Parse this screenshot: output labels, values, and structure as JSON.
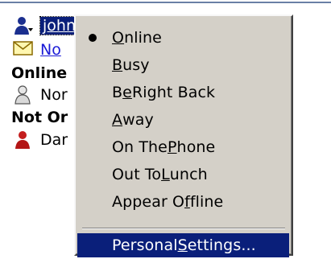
{
  "contacts": {
    "current_user": "john",
    "link_text": "No",
    "group_online": "Online",
    "contact_online": "Nor",
    "group_offline": "Not Or",
    "contact_offline": "Dar"
  },
  "menu": {
    "items": [
      {
        "pre": "",
        "acc": "O",
        "post": "nline",
        "checked": true
      },
      {
        "pre": "",
        "acc": "B",
        "post": "usy"
      },
      {
        "pre": "B",
        "acc": "e",
        "post": " Right Back"
      },
      {
        "pre": "",
        "acc": "A",
        "post": "way"
      },
      {
        "pre": "On The ",
        "acc": "P",
        "post": "hone"
      },
      {
        "pre": "Out To ",
        "acc": "L",
        "post": "unch"
      },
      {
        "pre": "Appear O",
        "acc": "f",
        "post": "fline"
      },
      {
        "pre": "Personal ",
        "acc": "S",
        "post": "ettings..."
      }
    ]
  },
  "colors": {
    "highlight": "#0a1f7a",
    "menu_bg": "#d4d0c8",
    "link": "#1a1ad6"
  }
}
